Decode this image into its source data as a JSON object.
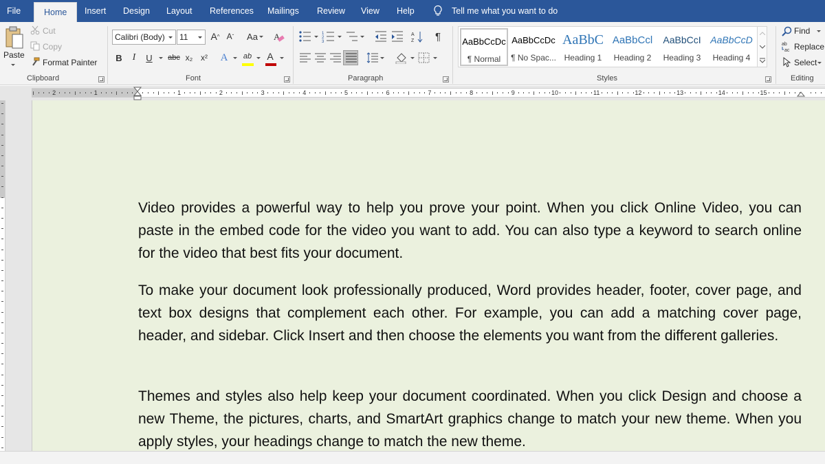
{
  "tabs": [
    {
      "label": "File"
    },
    {
      "label": "Home",
      "active": true
    },
    {
      "label": "Insert"
    },
    {
      "label": "Design"
    },
    {
      "label": "Layout"
    },
    {
      "label": "References"
    },
    {
      "label": "Mailings"
    },
    {
      "label": "Review"
    },
    {
      "label": "View"
    },
    {
      "label": "Help"
    }
  ],
  "tell_me": "Tell me what you want to do",
  "clipboard": {
    "group_label": "Clipboard",
    "paste": "Paste",
    "cut": "Cut",
    "copy": "Copy",
    "format_painter": "Format Painter"
  },
  "font": {
    "group_label": "Font",
    "family_value": "Calibri (Body)",
    "size_value": "11",
    "grow": "A",
    "shrink": "A",
    "change_case": "Aa",
    "bold": "B",
    "italic": "I",
    "underline": "U",
    "strikethrough": "abc",
    "subscript": "x₂",
    "superscript": "x²",
    "font_color_letter": "A",
    "text_effects_letter": "A",
    "highlight_label": "ab"
  },
  "paragraph": {
    "group_label": "Paragraph",
    "pilcrow": "¶"
  },
  "styles": {
    "group_label": "Styles",
    "items": [
      {
        "sample": "AaBbCcDc",
        "name": "¶ Normal"
      },
      {
        "sample": "AaBbCcDc",
        "name": "¶ No Spac..."
      },
      {
        "sample": "AaBbC",
        "name": "Heading 1"
      },
      {
        "sample": "AaBbCcl",
        "name": "Heading 2"
      },
      {
        "sample": "AaBbCcI",
        "name": "Heading 3"
      },
      {
        "sample": "AaBbCcD",
        "name": "Heading 4"
      }
    ]
  },
  "editing": {
    "group_label": "Editing",
    "find": "Find",
    "replace": "Replace",
    "select": "Select"
  },
  "ruler": {
    "numbers_left": [
      "2",
      "1"
    ],
    "numbers_right": [
      "1",
      "2",
      "3",
      "4",
      "5",
      "6",
      "7",
      "8",
      "9",
      "10",
      "11",
      "12",
      "13",
      "14",
      "15"
    ]
  },
  "document": {
    "paragraphs": [
      "Video provides a powerful way to help you prove your point. When you click Online Video, you can paste in the embed code for the video you want to add. You can also type a keyword to search online for the video that best fits your document.",
      "To make your document look professionally produced, Word provides header, footer, cover page, and text box designs that complement each other. For example, you can add a matching cover page, header, and sidebar. Click Insert and then choose the elements you want from the different galleries.",
      "Themes and styles also help keep your document coordinated. When you click Design and choose a new Theme, the pictures, charts, and SmartArt graphics change to match your new theme. When you apply styles, your headings change to match the new theme."
    ]
  },
  "colors": {
    "tab_bar": "#2b579a",
    "ribbon": "#f3f3f3",
    "page_background": "#ebf1de",
    "font_color_bar": "#c00000",
    "highlight_bar": "#ffff00"
  }
}
